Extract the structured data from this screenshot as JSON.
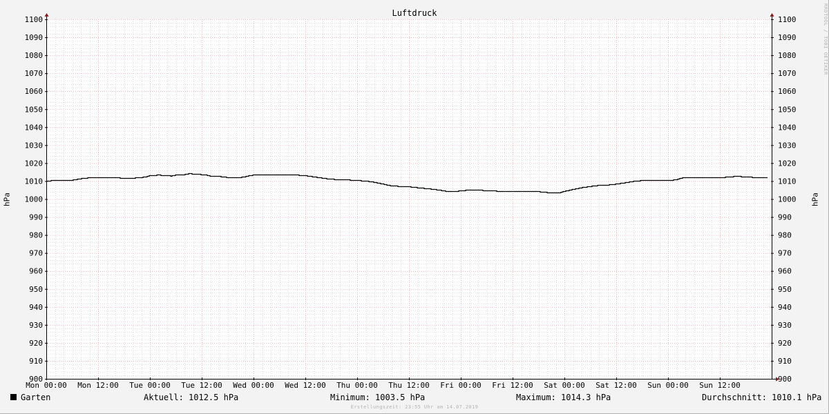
{
  "chart_data": {
    "type": "line",
    "title": "Luftdruck",
    "ylabel": "hPa",
    "ylim": [
      900,
      1100
    ],
    "y_ticks": [
      "900",
      "910",
      "920",
      "930",
      "940",
      "950",
      "960",
      "970",
      "980",
      "990",
      "1000",
      "1010",
      "1020",
      "1030",
      "1040",
      "1050",
      "1060",
      "1070",
      "1080",
      "1090",
      "1100"
    ],
    "x_ticks": [
      "Mon 00:00",
      "Mon 12:00",
      "Tue 00:00",
      "Tue 12:00",
      "Wed 00:00",
      "Wed 12:00",
      "Thu 00:00",
      "Thu 12:00",
      "Fri 00:00",
      "Fri 12:00",
      "Sat 00:00",
      "Sat 12:00",
      "Sun 00:00",
      "Sun 12:00"
    ],
    "x_unit": "hours since Mon 00:00",
    "xlim": [
      0,
      168
    ],
    "grid": true,
    "series": [
      {
        "name": "Garten",
        "color": "#000000",
        "points": [
          [
            0,
            1010.2
          ],
          [
            2,
            1010.5
          ],
          [
            4,
            1010.5
          ],
          [
            6,
            1010.7
          ],
          [
            8,
            1011.5
          ],
          [
            9,
            1011.8
          ],
          [
            10,
            1012.0
          ],
          [
            12,
            1012.0
          ],
          [
            14,
            1012.0
          ],
          [
            16,
            1012.0
          ],
          [
            18,
            1011.8
          ],
          [
            20,
            1011.8
          ],
          [
            22,
            1012.2
          ],
          [
            23,
            1012.5
          ],
          [
            24,
            1013.2
          ],
          [
            26,
            1013.5
          ],
          [
            28,
            1013.2
          ],
          [
            29,
            1013.0
          ],
          [
            30,
            1013.5
          ],
          [
            32,
            1013.8
          ],
          [
            33,
            1014.3
          ],
          [
            35,
            1014.0
          ],
          [
            37,
            1013.5
          ],
          [
            38,
            1013.0
          ],
          [
            40,
            1012.8
          ],
          [
            42,
            1012.2
          ],
          [
            44,
            1012.0
          ],
          [
            46,
            1012.5
          ],
          [
            47,
            1013.2
          ],
          [
            48,
            1013.5
          ],
          [
            52,
            1013.5
          ],
          [
            56,
            1013.5
          ],
          [
            58,
            1013.5
          ],
          [
            60,
            1013.2
          ],
          [
            62,
            1012.5
          ],
          [
            64,
            1011.8
          ],
          [
            66,
            1011.2
          ],
          [
            68,
            1011.0
          ],
          [
            70,
            1010.8
          ],
          [
            72,
            1010.5
          ],
          [
            74,
            1010.2
          ],
          [
            76,
            1009.5
          ],
          [
            78,
            1008.5
          ],
          [
            80,
            1007.5
          ],
          [
            82,
            1007.2
          ],
          [
            84,
            1007.0
          ],
          [
            86,
            1006.5
          ],
          [
            88,
            1006.0
          ],
          [
            90,
            1005.5
          ],
          [
            92,
            1004.8
          ],
          [
            93,
            1004.3
          ],
          [
            95,
            1004.5
          ],
          [
            97,
            1005.0
          ],
          [
            99,
            1005.2
          ],
          [
            101,
            1005.0
          ],
          [
            103,
            1004.8
          ],
          [
            105,
            1004.5
          ],
          [
            108,
            1004.5
          ],
          [
            112,
            1004.5
          ],
          [
            114,
            1004.3
          ],
          [
            116,
            1003.8
          ],
          [
            117,
            1003.5
          ],
          [
            119,
            1003.8
          ],
          [
            120,
            1004.5
          ],
          [
            122,
            1005.5
          ],
          [
            124,
            1006.5
          ],
          [
            126,
            1007.2
          ],
          [
            128,
            1007.8
          ],
          [
            130,
            1008.0
          ],
          [
            132,
            1008.5
          ],
          [
            134,
            1009.2
          ],
          [
            136,
            1010.0
          ],
          [
            138,
            1010.5
          ],
          [
            140,
            1010.7
          ],
          [
            142,
            1010.5
          ],
          [
            144,
            1010.5
          ],
          [
            145,
            1010.7
          ],
          [
            146,
            1011.0
          ],
          [
            147,
            1011.8
          ],
          [
            148,
            1012.2
          ],
          [
            150,
            1012.2
          ],
          [
            152,
            1012.0
          ],
          [
            154,
            1012.0
          ],
          [
            156,
            1012.0
          ],
          [
            158,
            1012.5
          ],
          [
            160,
            1012.8
          ],
          [
            162,
            1012.5
          ],
          [
            164,
            1012.2
          ],
          [
            166,
            1012.0
          ],
          [
            168,
            1012.5
          ]
        ]
      }
    ]
  },
  "legend": {
    "series_name": "Garten",
    "current": "Aktuell: 1012.5 hPa",
    "minimum": "Minimum: 1003.5 hPa",
    "maximum": "Maximum: 1014.3 hPa",
    "average": "Durchschnitt: 1010.1 hPa"
  },
  "footer": "Erstellungszeit: 23:55 Uhr am 14.07.2019",
  "watermark": "RRDTOOL / TOBI OETIKER",
  "colors": {
    "background": "#f3f3f3",
    "plot_background": "#ffffff",
    "major_grid": "#e8a8b0",
    "minor_grid": "#c8c8c8",
    "axis": "#000000",
    "arrow": "#8b1a1a",
    "line": "#000000"
  }
}
